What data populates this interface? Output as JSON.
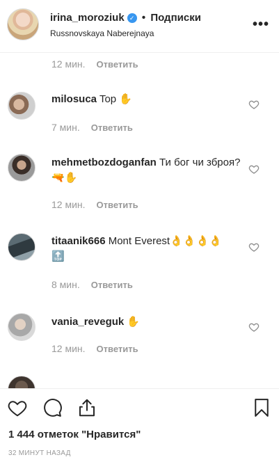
{
  "header": {
    "username": "irina_moroziuk",
    "verified_icon": "verified-badge-icon",
    "separator": "•",
    "follow_label": "Подписки",
    "location": "Russnovskaya Naberejnaya",
    "more_label": "•••"
  },
  "comments": [
    {
      "user": "",
      "text": "",
      "time": "12 мин.",
      "reply": "Ответить"
    },
    {
      "user": "milosuca",
      "text": "Top ✋",
      "time": "7 мин.",
      "reply": "Ответить"
    },
    {
      "user": "mehmetbozdoganfan",
      "text": "Ти бог чи зброя?🔫✋",
      "time": "12 мин.",
      "reply": "Ответить"
    },
    {
      "user": "titaanik666",
      "text": "Mont Everest👌👌👌👌🔝",
      "time": "8 мин.",
      "reply": "Ответить"
    },
    {
      "user": "vania_reveguk",
      "text": "✋",
      "time": "12 мин.",
      "reply": "Ответить"
    },
    {
      "user": "",
      "text": "",
      "time": "",
      "reply": ""
    }
  ],
  "footer": {
    "likes": "1 444 отметок \"Нравится\"",
    "time_ago": "32 МИНУТ НАЗАД"
  },
  "colors": {
    "text": "#262626",
    "muted": "#999999",
    "verified": "#3897f0",
    "border": "#efefef"
  }
}
